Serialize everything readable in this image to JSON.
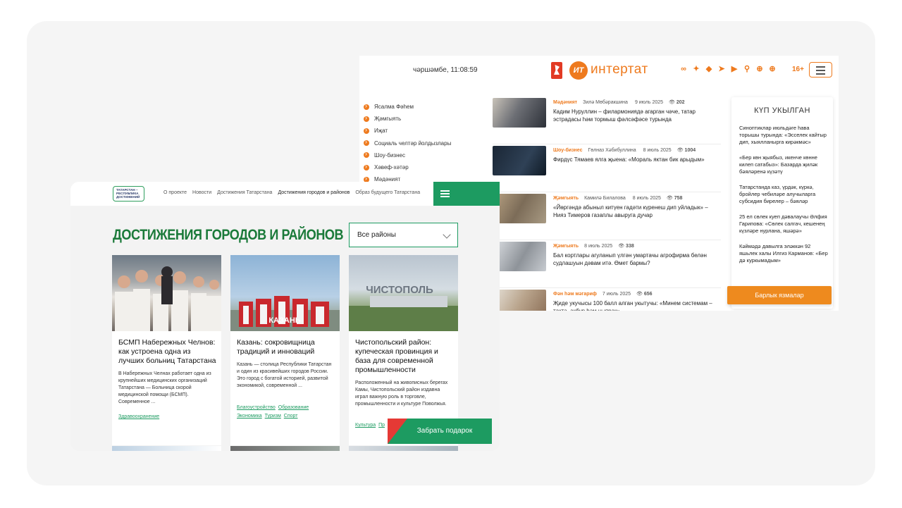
{
  "intertat": {
    "date_time": "чәршәмбе, 11:08:59",
    "logo_mark": "ИТ",
    "logo_text": "интертат",
    "social_icons": [
      "binoculars-icon",
      "twitter-icon",
      "vk-icon",
      "telegram-icon",
      "youtube-icon",
      "ok-icon",
      "plus-icon",
      "plus-icon"
    ],
    "age_rating": "16+",
    "nav": [
      "Ясалма Фәһем",
      "Җәмгыять",
      "Иҗат",
      "Социаль челтәр йолдызлары",
      "Шоу-бизнес",
      "Хәвеф-хәтәр",
      "Мәдәният"
    ],
    "news": [
      {
        "category": "Мәдәният",
        "author": "Зилә Мөбәракшина",
        "date": "9 июль 2025",
        "views": "202",
        "title": "Кадим Нуруллин – филармониядә агарган чәче, татар эстрадасы һәм тормыш фәлсәфәсе турында",
        "thumb": "#6d6f75"
      },
      {
        "category": "Шоу-бизнес",
        "author": "Гөлназ Хәбибуллина",
        "date": "8 июль 2025",
        "views": "1004",
        "title": "Фирдүс Тямаев ялга җыена: «Мораль яктан бик арыдым»",
        "thumb": "#233447"
      },
      {
        "category": "Җәмгыять",
        "author": "Камилә Билалова",
        "date": "8 июль 2025",
        "views": "758",
        "title": "«Йөргәндә абыныл китүен гадәти күренеш дип уйладык» – Нияз Тимеров газаплы авыруга дучар",
        "thumb": "#8a7c68"
      },
      {
        "category": "Җәмгыять",
        "author": "",
        "date": "8 июль 2025",
        "views": "338",
        "title": "Бал кортлары агуланып үлгән умартачы агрофирма белән судлашуын дәвам итә. Өмет бармы?",
        "thumb": "#9fa3a8"
      },
      {
        "category": "Фән һәм мәгариф",
        "author": "",
        "date": "7 июль 2025",
        "views": "656",
        "title": "Җиде укучысы 100 балл алган укытучы: «Минем системам – тактә, акбур һәм чыпрак»",
        "thumb": "#b9a48c"
      }
    ],
    "popular_heading": "КҮП УКЫЛГАН",
    "popular": [
      "Синоптиклар июльдәге һава торышы турында: «Эсселек кайтыр дип, хыялланырга кирәкмәс»",
      "«Бер көн җыябыз, икенче көнне килеп сатабыз»: Базарда җиләк бәяләренә күзәтү",
      "Татарстанда каз, үрдәк, күркә, бройлер чебиләре алучыларга субсидия бирелер – бәяләр",
      "25 ел сөлек куеп дәвалаучы Әлфия Гарипова: «Сөлек салгач, кешенең күзләре нурлана, яшәрә»",
      "Кәймәдә давылга эләккән 92 яшьлек халы Илгиз Карманов: «Бер дә куркымадым»"
    ],
    "all_button": "Барлык язмалар"
  },
  "tatarstan": {
    "logo_text": [
      "ТАТАРСТАН –",
      "РЕСПУБЛИКА",
      "ДОСТИЖЕНИЙ"
    ],
    "nav": [
      "О проекте",
      "Новости",
      "Достижения Татарстана",
      "Достижения городов и районов",
      "Образ будущего Татарстана"
    ],
    "heading": "ДОСТИЖЕНИЯ ГОРОДОВ И РАЙОНОВ",
    "select_value": "Все районы",
    "cards": [
      {
        "title": "БСМП Набережных Челнов: как устроена одна из лучших больниц Татарстана",
        "desc": "В Набережных Челнах работает одна из крупнейших медицинских организаций Татарстана — Больница скорой медицинской помощи (БСМП). Современное ...",
        "tags": [
          "Здравоохранение"
        ]
      },
      {
        "title": "Казань: сокровищница традиций и инноваций",
        "desc": "Казань — столица Республики Татарстан и один из красивейших городов России. Это город с богатой историей, развитой экономикой, современной ...",
        "tags": [
          "Благоустройство",
          "Образование",
          "Экономика",
          "Туризм",
          "Спорт"
        ]
      },
      {
        "title": "Чистопольский район: купеческая провинция и база для современной промышленности",
        "desc": "Расположенный на живописных берегах Камы, Чистопольский район издавна играл важную роль в торговле, промышленности и культуре Поволжья.",
        "tags": [
          "Культура",
          "Пр"
        ]
      }
    ],
    "gift_button": "Забрать подарок",
    "image_texts": [
      "КАЗАНЬ",
      "ЧИСТОПОЛЬ"
    ]
  },
  "colors": {
    "intertat_accent": "#ee7a1e",
    "tatarstan_green": "#1d9b61",
    "heading_green": "#1b7a3a",
    "gift_red": "#e53935"
  }
}
